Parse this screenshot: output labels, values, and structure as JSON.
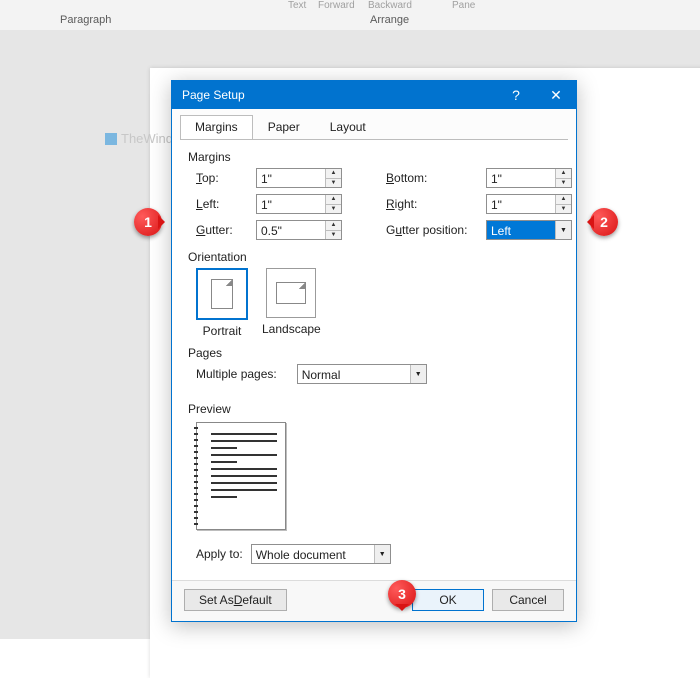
{
  "ribbon": {
    "group_paragraph": "Paragraph",
    "group_arrange": "Arrange",
    "mini_text": "Text",
    "mini_forward": "Forward",
    "mini_backward": "Backward",
    "mini_pane": "Pane"
  },
  "watermark": "TheWindowsClub",
  "dialog": {
    "title": "Page Setup",
    "help": "?",
    "close": "✕",
    "tabs": {
      "margins": "Margins",
      "paper": "Paper",
      "layout": "Layout"
    },
    "active_tab": "margins",
    "margins": {
      "section": "Margins",
      "top_label": "Top:",
      "top_underline": "T",
      "top_value": "1\"",
      "bottom_label": "Bottom:",
      "bottom_underline": "B",
      "bottom_value": "1\"",
      "left_label": "Left:",
      "left_underline": "L",
      "left_value": "1\"",
      "right_label": "Right:",
      "right_underline": "R",
      "right_value": "1\"",
      "gutter_label": "Gutter:",
      "gutter_underline": "G",
      "gutter_value": "0.5\"",
      "gutterpos_label": "Gutter position:",
      "gutterpos_underline": "u",
      "gutterpos_value": "Left"
    },
    "orientation": {
      "section": "Orientation",
      "portrait": "Portrait",
      "landscape": "Landscape",
      "selected": "portrait"
    },
    "pages": {
      "section": "Pages",
      "multiple_label": "Multiple pages:",
      "multiple_underline": "M",
      "multiple_value": "Normal"
    },
    "preview": {
      "section": "Preview"
    },
    "apply": {
      "label": "Apply to:",
      "underline": "y",
      "value": "Whole document"
    },
    "buttons": {
      "set_default": "Set As Default",
      "set_default_underline": "D",
      "ok": "OK",
      "cancel": "Cancel"
    }
  },
  "callouts": {
    "c1": "1",
    "c2": "2",
    "c3": "3"
  }
}
